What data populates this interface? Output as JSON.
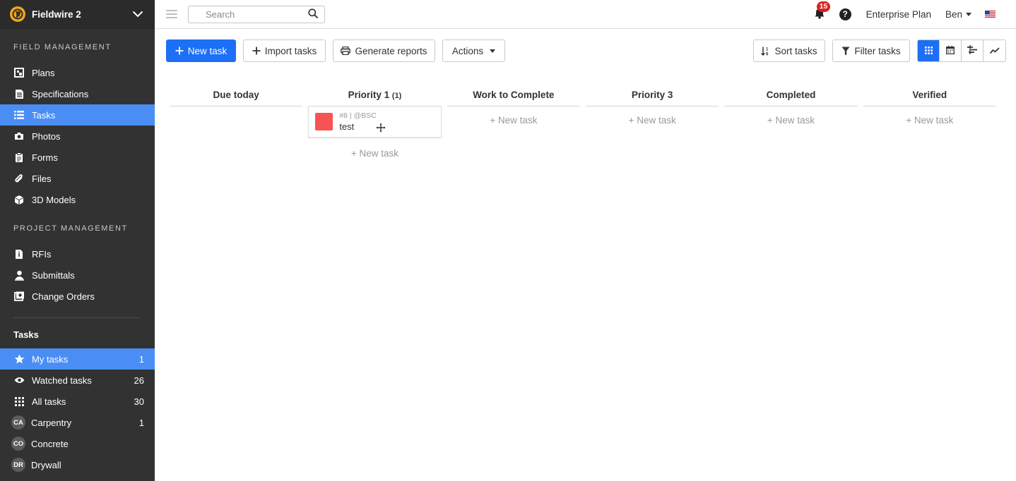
{
  "project": {
    "name": "Fieldwire 2"
  },
  "sidebar": {
    "field_management_title": "FIELD MANAGEMENT",
    "field_items": [
      {
        "label": "Plans",
        "icon": "plans-icon"
      },
      {
        "label": "Specifications",
        "icon": "specifications-icon"
      },
      {
        "label": "Tasks",
        "icon": "tasks-list-icon",
        "active": true
      },
      {
        "label": "Photos",
        "icon": "camera-icon"
      },
      {
        "label": "Forms",
        "icon": "clipboard-icon"
      },
      {
        "label": "Files",
        "icon": "paperclip-icon"
      },
      {
        "label": "3D Models",
        "icon": "cube-icon"
      }
    ],
    "project_management_title": "PROJECT MANAGEMENT",
    "project_items": [
      {
        "label": "RFIs",
        "icon": "rfi-icon"
      },
      {
        "label": "Submittals",
        "icon": "user-icon"
      },
      {
        "label": "Change Orders",
        "icon": "change-orders-icon"
      }
    ],
    "tasks_title": "Tasks",
    "task_filters": [
      {
        "label": "My tasks",
        "count": "1",
        "icon": "star-icon",
        "active": true
      },
      {
        "label": "Watched tasks",
        "count": "26",
        "icon": "eye-icon"
      },
      {
        "label": "All tasks",
        "count": "30",
        "icon": "grid-icon"
      },
      {
        "label": "Carpentry",
        "count": "1",
        "avatar": "CA"
      },
      {
        "label": "Concrete",
        "count": "",
        "avatar": "CO"
      },
      {
        "label": "Drywall",
        "count": "",
        "avatar": "DR"
      }
    ]
  },
  "topbar": {
    "search_placeholder": "Search",
    "notification_count": "15",
    "plan": "Enterprise Plan",
    "user": "Ben"
  },
  "toolbar": {
    "new_task": "New task",
    "import_tasks": "Import tasks",
    "generate_reports": "Generate reports",
    "actions": "Actions",
    "sort_tasks": "Sort tasks",
    "filter_tasks": "Filter tasks"
  },
  "board": {
    "new_task_label": "+ New task",
    "columns": [
      {
        "title": "Due today",
        "count": ""
      },
      {
        "title": "Priority 1",
        "count": "(1)"
      },
      {
        "title": "Work to Complete",
        "count": ""
      },
      {
        "title": "Priority 3",
        "count": ""
      },
      {
        "title": "Completed",
        "count": ""
      },
      {
        "title": "Verified",
        "count": ""
      }
    ],
    "card": {
      "meta": "#8 | @BSC",
      "title": "test",
      "color": "#f75353"
    }
  },
  "colors": {
    "accent": "#1d6ff5",
    "sidebar": "#323232",
    "sidebar_active": "#4a8ef5",
    "badge": "#d9231f"
  }
}
